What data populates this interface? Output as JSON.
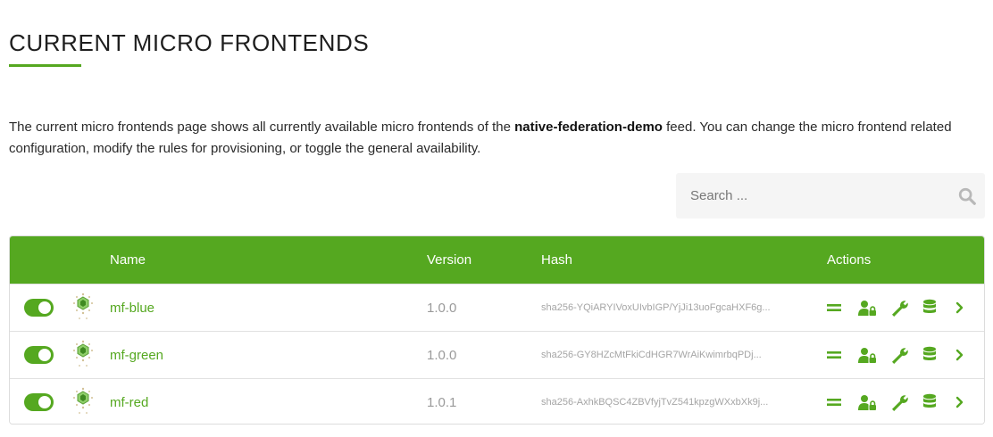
{
  "header": {
    "title": "CURRENT MICRO FRONTENDS"
  },
  "intro": {
    "text_before": "The current micro frontends page shows all currently available micro frontends of the ",
    "feed_name": "native-federation-demo",
    "text_after": " feed. You can change the micro frontend related configuration, modify the rules for provisioning, or toggle the general availability."
  },
  "search": {
    "placeholder": "Search ...",
    "value": "",
    "icon": "search-icon"
  },
  "table": {
    "columns": {
      "name": "Name",
      "version": "Version",
      "hash": "Hash",
      "actions": "Actions"
    },
    "rows": [
      {
        "enabled": true,
        "icon": "micro-frontend-icon",
        "name": "mf-blue",
        "version": "1.0.0",
        "hash": "sha256-YQiARYIVoxUIvbIGP/YjJi13uoFgcaHXF6g..."
      },
      {
        "enabled": true,
        "icon": "micro-frontend-icon",
        "name": "mf-green",
        "version": "1.0.0",
        "hash": "sha256-GY8HZcMtFkiCdHGR7WrAiKwimrbqPDj..."
      },
      {
        "enabled": true,
        "icon": "micro-frontend-icon",
        "name": "mf-red",
        "version": "1.0.1",
        "hash": "sha256-AxhkBQSC4ZBVfyjTvZ541kpzgWXxbXk9j..."
      }
    ],
    "action_icons": [
      "menu-icon",
      "user-lock-icon",
      "wrench-icon",
      "database-icon",
      "chevron-right-icon"
    ]
  },
  "colors": {
    "accent": "#55a820",
    "header_text": "#ffffff",
    "muted": "#9a9a9a"
  }
}
